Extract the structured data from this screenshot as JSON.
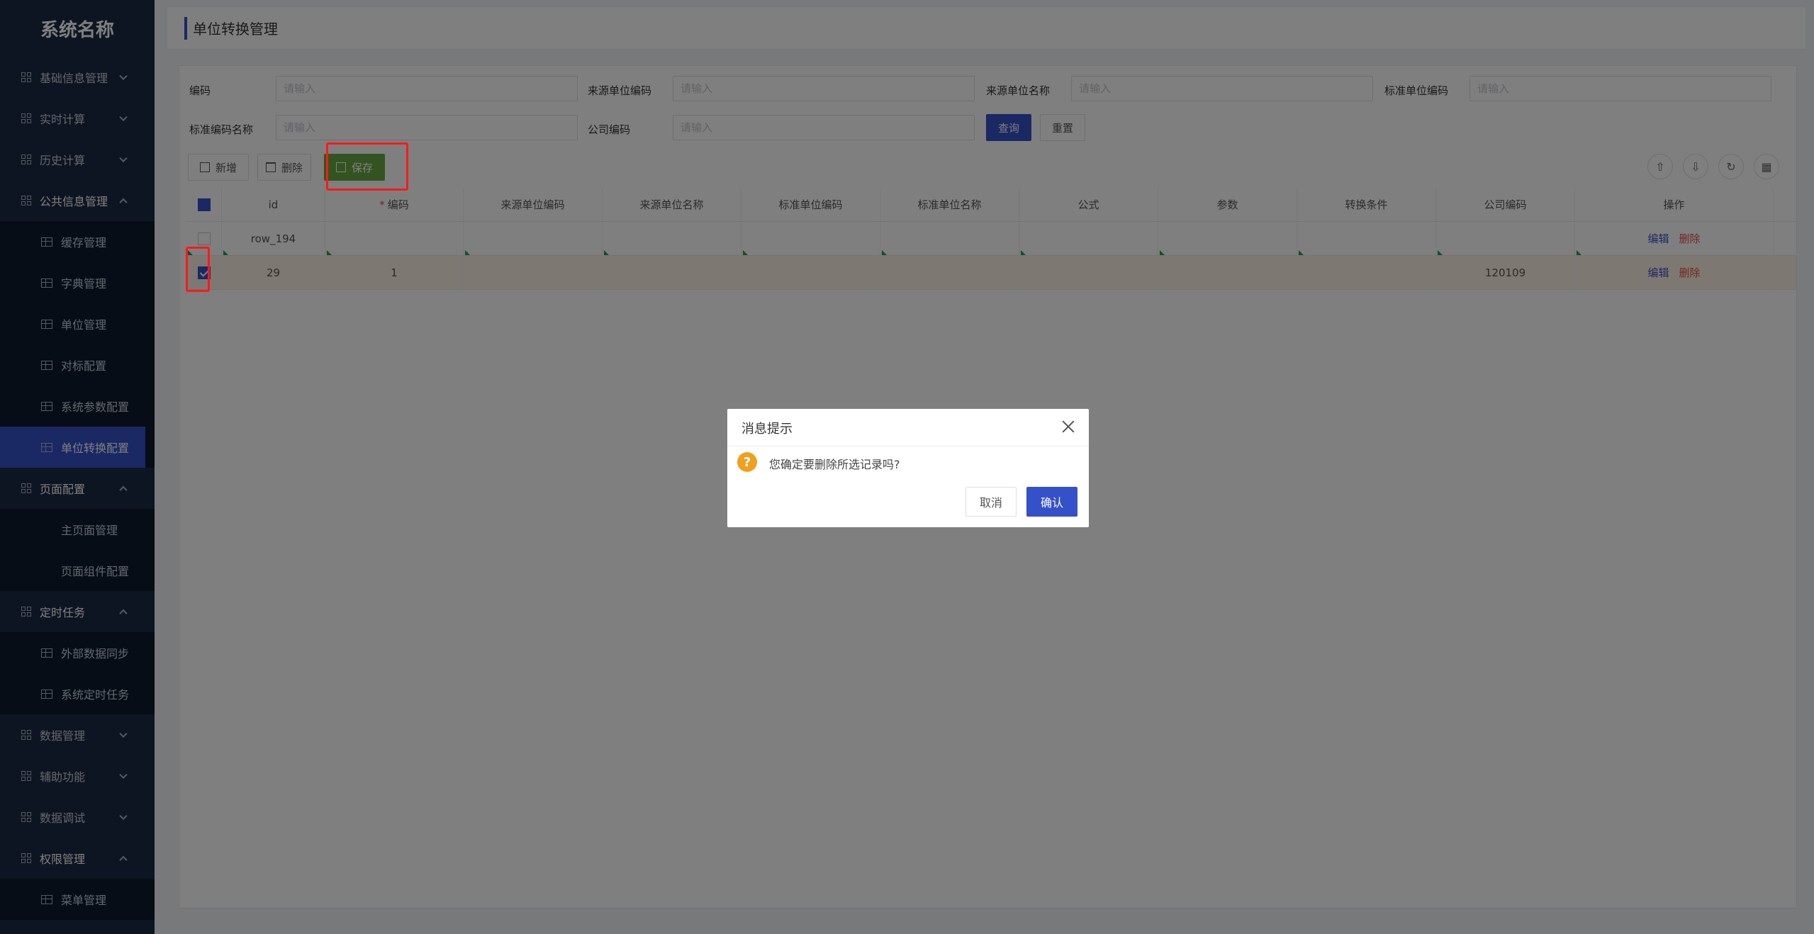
{
  "brand": "系统名称",
  "sidebar": {
    "items": [
      {
        "label": "基础信息管理",
        "expanded": false
      },
      {
        "label": "实时计算",
        "expanded": false
      },
      {
        "label": "历史计算",
        "expanded": false
      },
      {
        "label": "公共信息管理",
        "expanded": true,
        "children": [
          "缓存管理",
          "字典管理",
          "单位管理",
          "对标配置",
          "系统参数配置",
          "单位转换配置"
        ]
      },
      {
        "label": "页面配置",
        "expanded": true,
        "children": [
          "主页面管理",
          "页面组件配置"
        ]
      },
      {
        "label": "定时任务",
        "expanded": true,
        "children": [
          "外部数据同步",
          "系统定时任务"
        ]
      },
      {
        "label": "数据管理",
        "expanded": false
      },
      {
        "label": "辅助功能",
        "expanded": false
      },
      {
        "label": "数据调试",
        "expanded": false
      },
      {
        "label": "权限管理",
        "expanded": true,
        "children": [
          "菜单管理"
        ]
      }
    ],
    "active": "单位转换配置"
  },
  "page_title": "单位转换管理",
  "search": {
    "fields": [
      {
        "label": "编码",
        "placeholder": "请输入"
      },
      {
        "label": "来源单位编码",
        "placeholder": "请输入"
      },
      {
        "label": "来源单位名称",
        "placeholder": "请输入"
      },
      {
        "label": "标准单位编码",
        "placeholder": "请输入"
      },
      {
        "label": "标准编码名称",
        "placeholder": "请输入"
      },
      {
        "label": "公司编码",
        "placeholder": "请输入"
      }
    ],
    "query_label": "查询",
    "reset_label": "重置"
  },
  "toolbar": {
    "add_label": "新增",
    "delete_label": "删除",
    "save_label": "保存"
  },
  "table": {
    "columns": [
      "",
      "id",
      "编码",
      "来源单位编码",
      "来源单位名称",
      "标准单位编码",
      "标准单位名称",
      "公式",
      "参数",
      "转换条件",
      "公司编码",
      "操作"
    ],
    "rows": [
      {
        "checked": false,
        "id": "row_194",
        "code": "",
        "company": "",
        "edit": "编辑",
        "del": "删除"
      },
      {
        "checked": true,
        "id": "29",
        "code": "1",
        "company": "120109",
        "edit": "编辑",
        "del": "删除"
      }
    ]
  },
  "dialog": {
    "title": "消息提示",
    "message": "您确定要删除所选记录吗?",
    "cancel_label": "取消",
    "confirm_label": "确认"
  },
  "colors": {
    "sidebar_bg": "#1c2b45",
    "primary": "#3451c9",
    "success": "#67a940",
    "danger": "#e54a4a",
    "highlight": "#ff1a1a"
  }
}
